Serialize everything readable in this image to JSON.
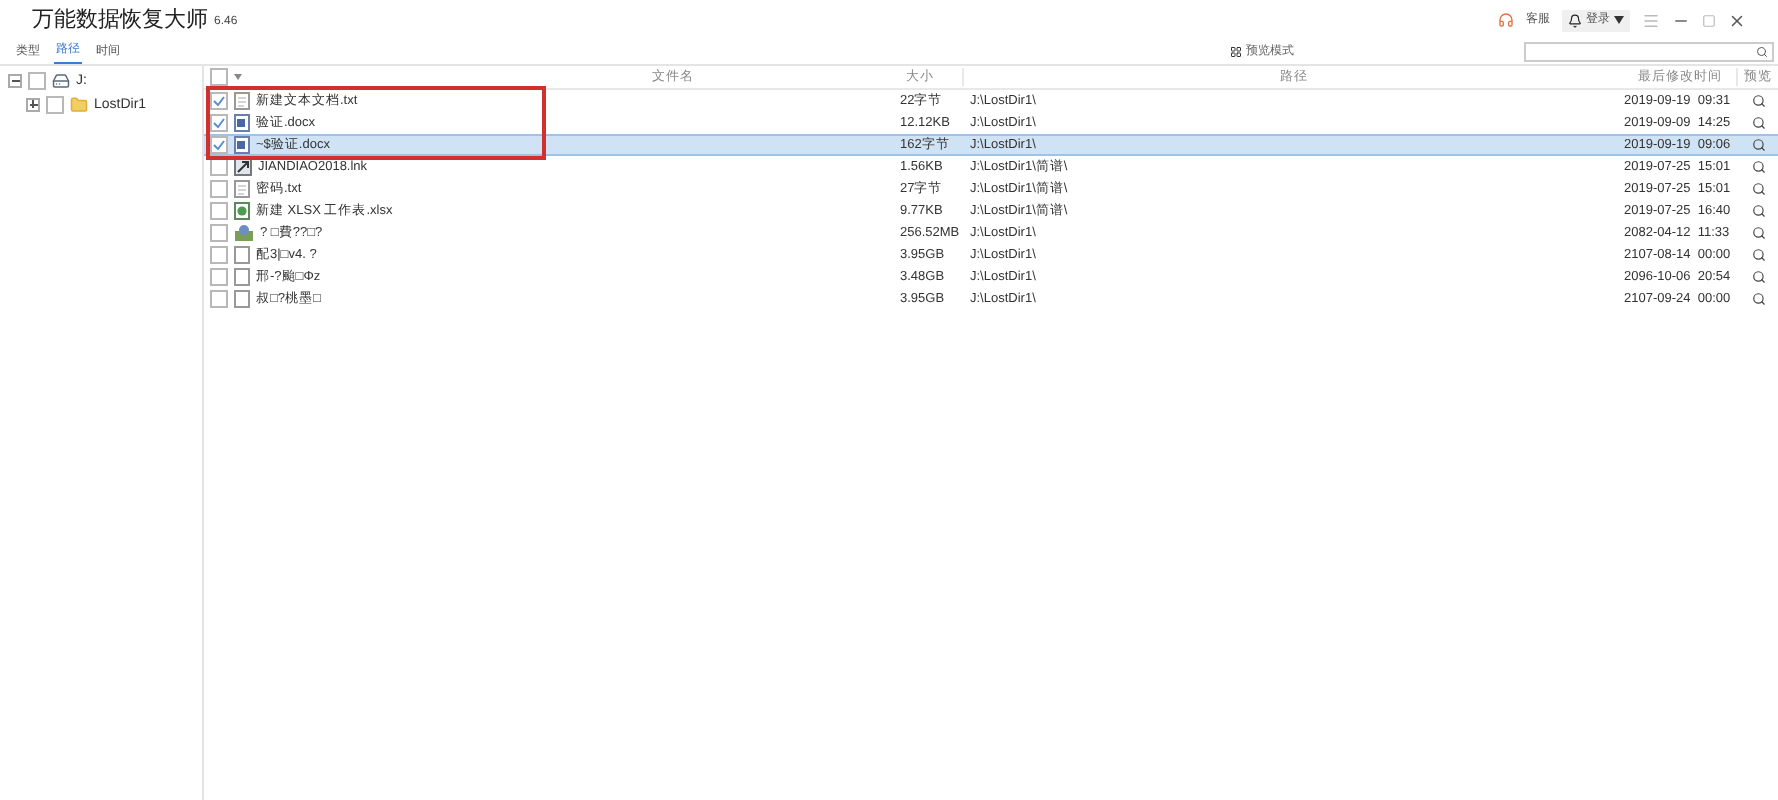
{
  "window": {
    "title": "万能数据恢复大师",
    "version": "6.46",
    "top_links": [
      "客服",
      "登录"
    ]
  },
  "tabs": [
    {
      "label": "类型",
      "selected": false
    },
    {
      "label": "路径",
      "selected": true
    },
    {
      "label": "时间",
      "selected": false
    }
  ],
  "view_mode": "预览模式",
  "tree": [
    {
      "label": "J:",
      "kind": "drive",
      "checked": false,
      "expanded": true,
      "children": [
        {
          "label": "LostDir1",
          "kind": "folder",
          "checked": false,
          "expanded": false
        }
      ]
    }
  ],
  "table": {
    "select_all_checked": false,
    "columns": [
      "文件名",
      "大小",
      "路径",
      "最后修改时间",
      "预览"
    ],
    "rows": [
      {
        "name": "新建文本文档.txt",
        "kind": "text",
        "size": "22字节",
        "path": "J:\\LostDir1\\",
        "modified": "2019-09-19  09:31",
        "checked": true,
        "selected": false,
        "outlined": true
      },
      {
        "name": "验证.docx",
        "kind": "doc",
        "size": "12.12KB",
        "path": "J:\\LostDir1\\",
        "modified": "2019-09-09  14:25",
        "checked": true,
        "selected": false,
        "outlined": true
      },
      {
        "name": "~$验证.docx",
        "kind": "doc",
        "size": "162字节",
        "path": "J:\\LostDir1\\",
        "modified": "2019-09-19  09:06",
        "checked": true,
        "selected": true,
        "outlined": true
      },
      {
        "name": "JIANDIAO2018.lnk",
        "kind": "link",
        "size": "1.56KB",
        "path": "J:\\LostDir1\\简谱\\",
        "modified": "2019-07-25  15:01",
        "checked": false,
        "selected": false,
        "outlined": false
      },
      {
        "name": "密码.txt",
        "kind": "text",
        "size": "27字节",
        "path": "J:\\LostDir1\\简谱\\",
        "modified": "2019-07-25  15:01",
        "checked": false,
        "selected": false,
        "outlined": false
      },
      {
        "name": "新建 XLSX 工作表.xlsx",
        "kind": "sheet",
        "size": "9.77KB",
        "path": "J:\\LostDir1\\简谱\\",
        "modified": "2019-07-25  16:40",
        "checked": false,
        "selected": false,
        "outlined": false
      },
      {
        "name": "?  □費??□?",
        "kind": "app",
        "size": "256.52MB",
        "path": "J:\\LostDir1\\",
        "modified": "2082-04-12  11:33",
        "checked": false,
        "selected": false,
        "outlined": false
      },
      {
        "name": "配3|□v4.  ?",
        "kind": "blank",
        "size": "3.95GB",
        "path": "J:\\LostDir1\\",
        "modified": "2107-08-14  00:00",
        "checked": false,
        "selected": false,
        "outlined": false
      },
      {
        "name": "邢-?颱□Φz",
        "kind": "blank",
        "size": "3.48GB",
        "path": "J:\\LostDir1\\",
        "modified": "2096-10-06  20:54",
        "checked": false,
        "selected": false,
        "outlined": false
      },
      {
        "name": "叔□?桃墨□",
        "kind": "blank",
        "size": "3.95GB",
        "path": "J:\\LostDir1\\",
        "modified": "2107-09-24  00:00",
        "checked": false,
        "selected": false,
        "outlined": false
      }
    ]
  }
}
